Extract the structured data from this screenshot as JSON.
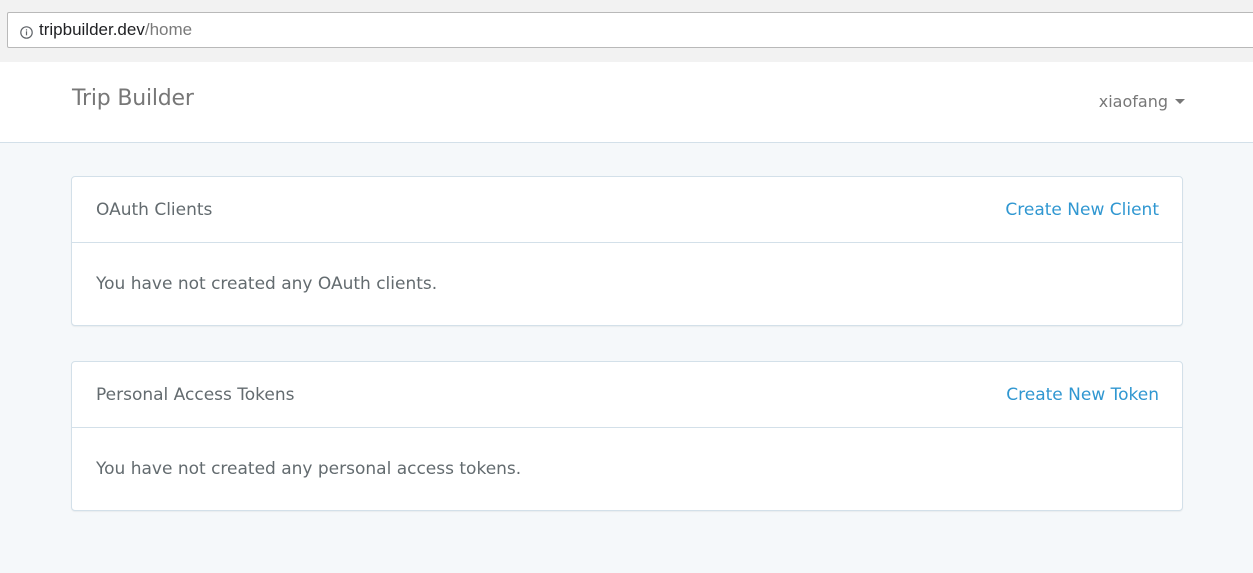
{
  "browser": {
    "url_host": "tripbuilder.dev",
    "url_path": "/home",
    "icon": "info-icon"
  },
  "navbar": {
    "brand": "Trip Builder",
    "user_name": "xiaofang",
    "user_icon": "caret-down-icon"
  },
  "oauth_clients": {
    "title": "OAuth Clients",
    "action_label": "Create New Client",
    "empty_message": "You have not created any OAuth clients."
  },
  "personal_tokens": {
    "title": "Personal Access Tokens",
    "action_label": "Create New Token",
    "empty_message": "You have not created any personal access tokens."
  },
  "colors": {
    "link": "#3097d1",
    "page_bg": "#f5f8fa",
    "border": "#d3e0e9"
  }
}
